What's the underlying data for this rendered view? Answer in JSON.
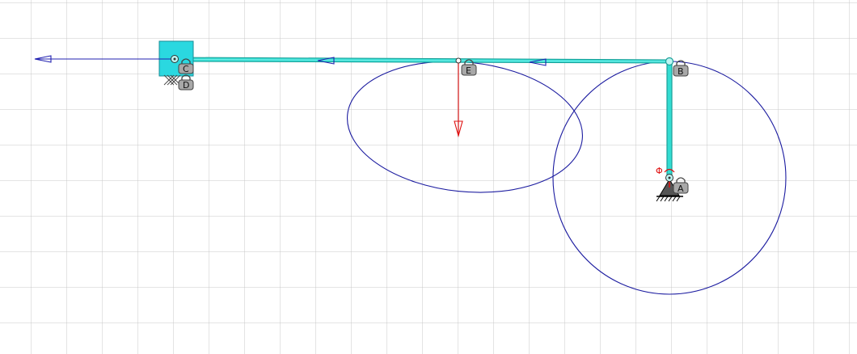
{
  "colors": {
    "background": "#ffffff",
    "grid": "#c8c8c8",
    "link_fill": "#33dcd2",
    "link_edge": "#1a9f98",
    "slider_fill": "#2ad8e0",
    "trajectory": "#1c1ca0",
    "velocity_vector": "#2020b0",
    "force_vector": "#e01010",
    "lock_fill": "#a8a8a8",
    "lock_edge": "#444444",
    "ground": "#000000"
  },
  "labels": {
    "joint_a": "A",
    "joint_b": "B",
    "joint_c": "C",
    "joint_d": "D",
    "joint_e": "E",
    "angle_symbol": "Φ"
  },
  "icons": {
    "lock": "padlock-icon",
    "ground": "ground-support-icon",
    "slider_anchor": "crosshatch-anchor-icon"
  }
}
